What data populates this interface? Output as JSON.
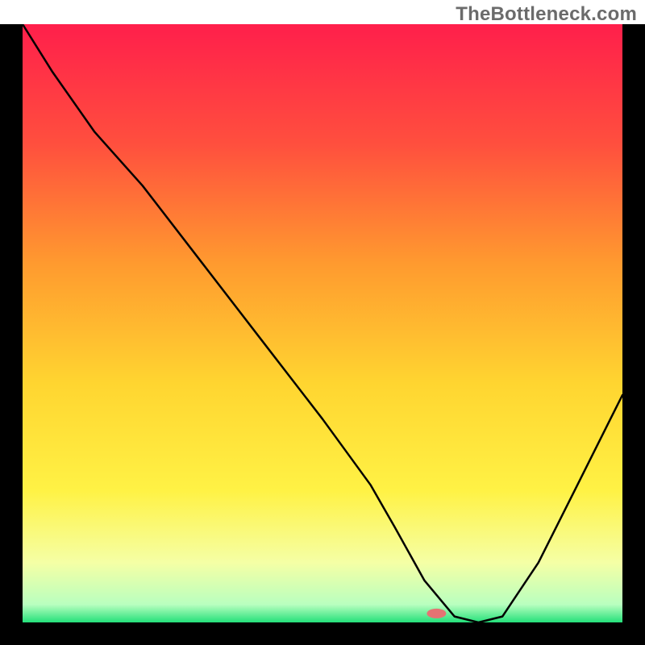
{
  "watermark": "TheBottleneck.com",
  "chart_data": {
    "type": "line",
    "title": "",
    "xlabel": "",
    "ylabel": "",
    "xlim": [
      0,
      100
    ],
    "ylim": [
      0,
      100
    ],
    "grid": false,
    "legend": false,
    "background_gradient_stops": [
      {
        "pct": 0,
        "color": "#ff1f4b"
      },
      {
        "pct": 20,
        "color": "#ff4f3e"
      },
      {
        "pct": 40,
        "color": "#ff9a2f"
      },
      {
        "pct": 60,
        "color": "#ffd530"
      },
      {
        "pct": 78,
        "color": "#fff245"
      },
      {
        "pct": 90,
        "color": "#f5ffa5"
      },
      {
        "pct": 97,
        "color": "#b9ffbf"
      },
      {
        "pct": 100,
        "color": "#24e07a"
      }
    ],
    "series": [
      {
        "name": "bottleneck-curve",
        "stroke": "#000000",
        "stroke_width": 2.5,
        "x": [
          0,
          5,
          12,
          20,
          30,
          40,
          50,
          58,
          62,
          67,
          72,
          76,
          80,
          86,
          92,
          98,
          100
        ],
        "y": [
          100,
          92,
          82,
          73,
          60,
          47,
          34,
          23,
          16,
          7,
          1,
          0,
          1,
          10,
          22,
          34,
          38
        ]
      }
    ],
    "marker": {
      "name": "selected-point",
      "x": 69,
      "y": 1.5,
      "color": "#e57373",
      "rx": 12,
      "ry": 6
    },
    "frame_color": "#000000"
  }
}
